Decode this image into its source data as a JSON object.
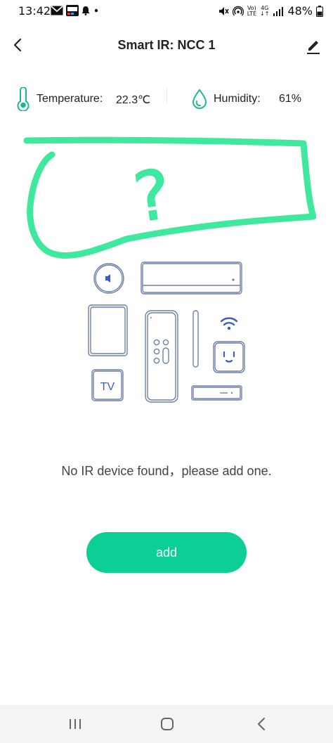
{
  "status_bar": {
    "time": "13:42",
    "network_top": "Vo)",
    "network_bottom": "LTE",
    "data_top": "4G",
    "data_bottom": "↓↑",
    "battery": "48%"
  },
  "header": {
    "title": "Smart IR: NCC 1"
  },
  "sensors": {
    "temperature_label": "Temperature:",
    "temperature_value": "22.3℃",
    "humidity_label": "Humidity:",
    "humidity_value": "61%"
  },
  "illustration": {
    "tv_label": "TV"
  },
  "annotation": {
    "mark": "?"
  },
  "empty_state": {
    "message": "No IR device found，please add one."
  },
  "actions": {
    "add_label": "add"
  },
  "colors": {
    "accent": "#0ccf95",
    "icon_teal": "#1fb893",
    "scribble": "#3ee89c",
    "line_art": "#6e7fa8"
  }
}
